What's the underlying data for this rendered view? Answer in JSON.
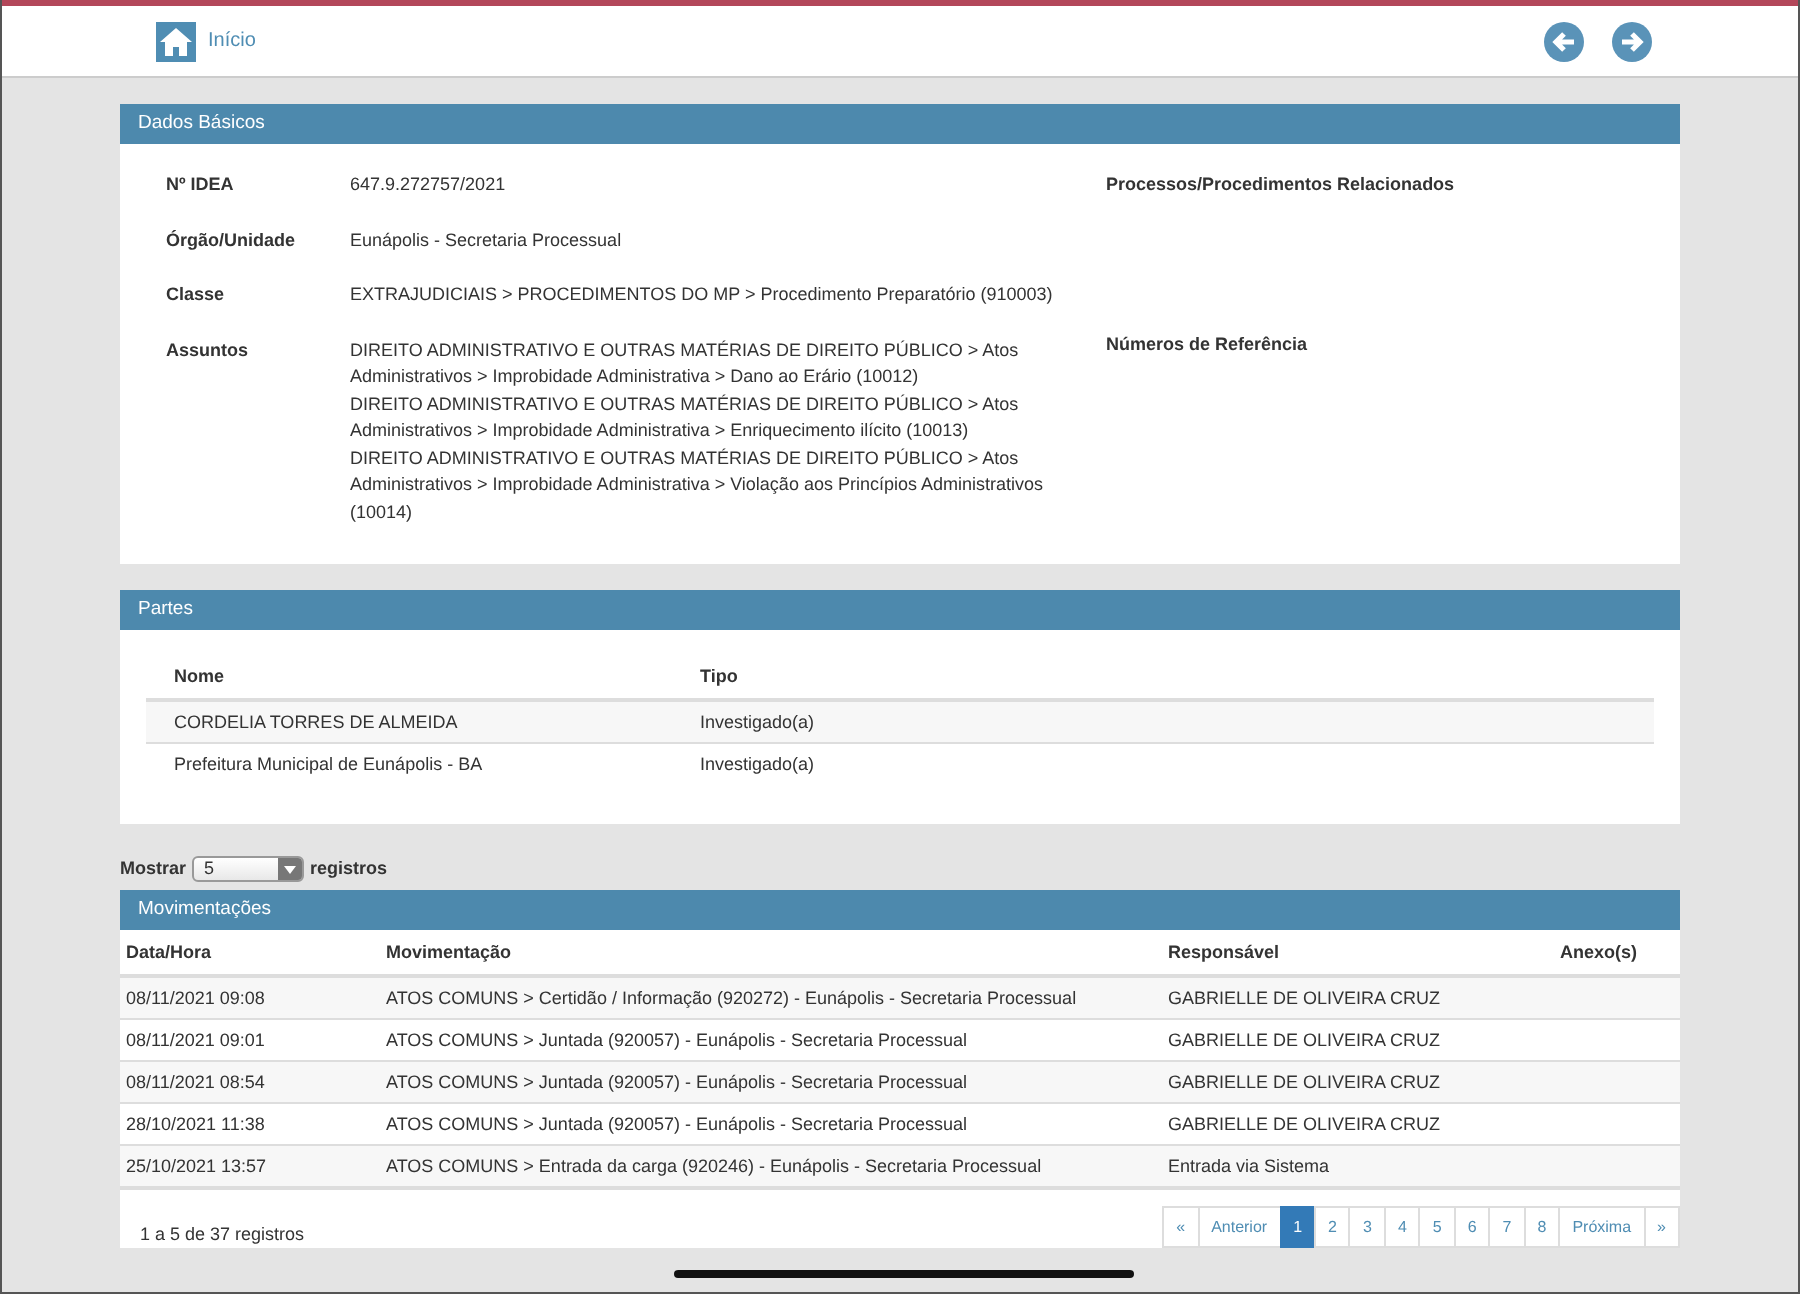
{
  "header": {
    "home_label": "Início"
  },
  "dados_basicos": {
    "title": "Dados Básicos",
    "fields": [
      {
        "label": "Nº IDEA",
        "value": [
          "647.9.272757/2021"
        ]
      },
      {
        "label": "Órgão/Unidade",
        "value": [
          "Eunápolis - Secretaria Processual"
        ]
      },
      {
        "label": "Classe",
        "value": [
          "EXTRAJUDICIAIS > PROCEDIMENTOS DO MP > Procedimento Preparatório (910003)"
        ]
      },
      {
        "label": "Assuntos",
        "value": [
          "DIREITO ADMINISTRATIVO E OUTRAS MATÉRIAS DE DIREITO PÚBLICO > Atos Administrativos > Improbidade Administrativa > Dano ao Erário (10012)",
          "DIREITO ADMINISTRATIVO E OUTRAS MATÉRIAS DE DIREITO PÚBLICO > Atos Administrativos > Improbidade Administrativa > Enriquecimento ilícito (10013)",
          "DIREITO ADMINISTRATIVO E OUTRAS MATÉRIAS DE DIREITO PÚBLICO > Atos Administrativos > Improbidade Administrativa > Violação aos Princípios Administrativos (10014)"
        ]
      }
    ],
    "side_labels": [
      "Processos/Procedimentos Relacionados",
      "Números de Referência"
    ]
  },
  "partes": {
    "title": "Partes",
    "columns": [
      "Nome",
      "Tipo"
    ],
    "rows": [
      [
        "CORDELIA TORRES DE ALMEIDA",
        "Investigado(a)"
      ],
      [
        "Prefeitura Municipal de Eunápolis - BA",
        "Investigado(a)"
      ]
    ]
  },
  "length_control": {
    "prefix": "Mostrar",
    "value": "5",
    "suffix": "registros"
  },
  "movimentacoes": {
    "title": "Movimentações",
    "columns": [
      "Data/Hora",
      "Movimentação",
      "Responsável",
      "Anexo(s)"
    ],
    "rows": [
      [
        "08/11/2021 09:08",
        "ATOS COMUNS > Certidão / Informação (920272) - Eunápolis - Secretaria Processual",
        "GABRIELLE DE OLIVEIRA CRUZ"
      ],
      [
        "08/11/2021 09:01",
        "ATOS COMUNS > Juntada (920057) - Eunápolis - Secretaria Processual",
        "GABRIELLE DE OLIVEIRA CRUZ"
      ],
      [
        "08/11/2021 08:54",
        "ATOS COMUNS > Juntada (920057) - Eunápolis - Secretaria Processual",
        "GABRIELLE DE OLIVEIRA CRUZ"
      ],
      [
        "28/10/2021 11:38",
        "ATOS COMUNS > Juntada (920057) - Eunápolis - Secretaria Processual",
        "GABRIELLE DE OLIVEIRA CRUZ"
      ],
      [
        "25/10/2021 13:57",
        "ATOS COMUNS > Entrada da carga (920246) - Eunápolis - Secretaria Processual",
        "Entrada via Sistema"
      ]
    ],
    "info": "1 a 5 de 37 registros",
    "pagination": [
      {
        "label": "«",
        "selected": false
      },
      {
        "label": "Anterior",
        "selected": false
      },
      {
        "label": "1",
        "selected": true
      },
      {
        "label": "2",
        "selected": false
      },
      {
        "label": "3",
        "selected": false
      },
      {
        "label": "4",
        "selected": false
      },
      {
        "label": "5",
        "selected": false
      },
      {
        "label": "6",
        "selected": false
      },
      {
        "label": "7",
        "selected": false
      },
      {
        "label": "8",
        "selected": false
      },
      {
        "label": "Próxima",
        "selected": false
      },
      {
        "label": "»",
        "selected": false
      }
    ]
  }
}
